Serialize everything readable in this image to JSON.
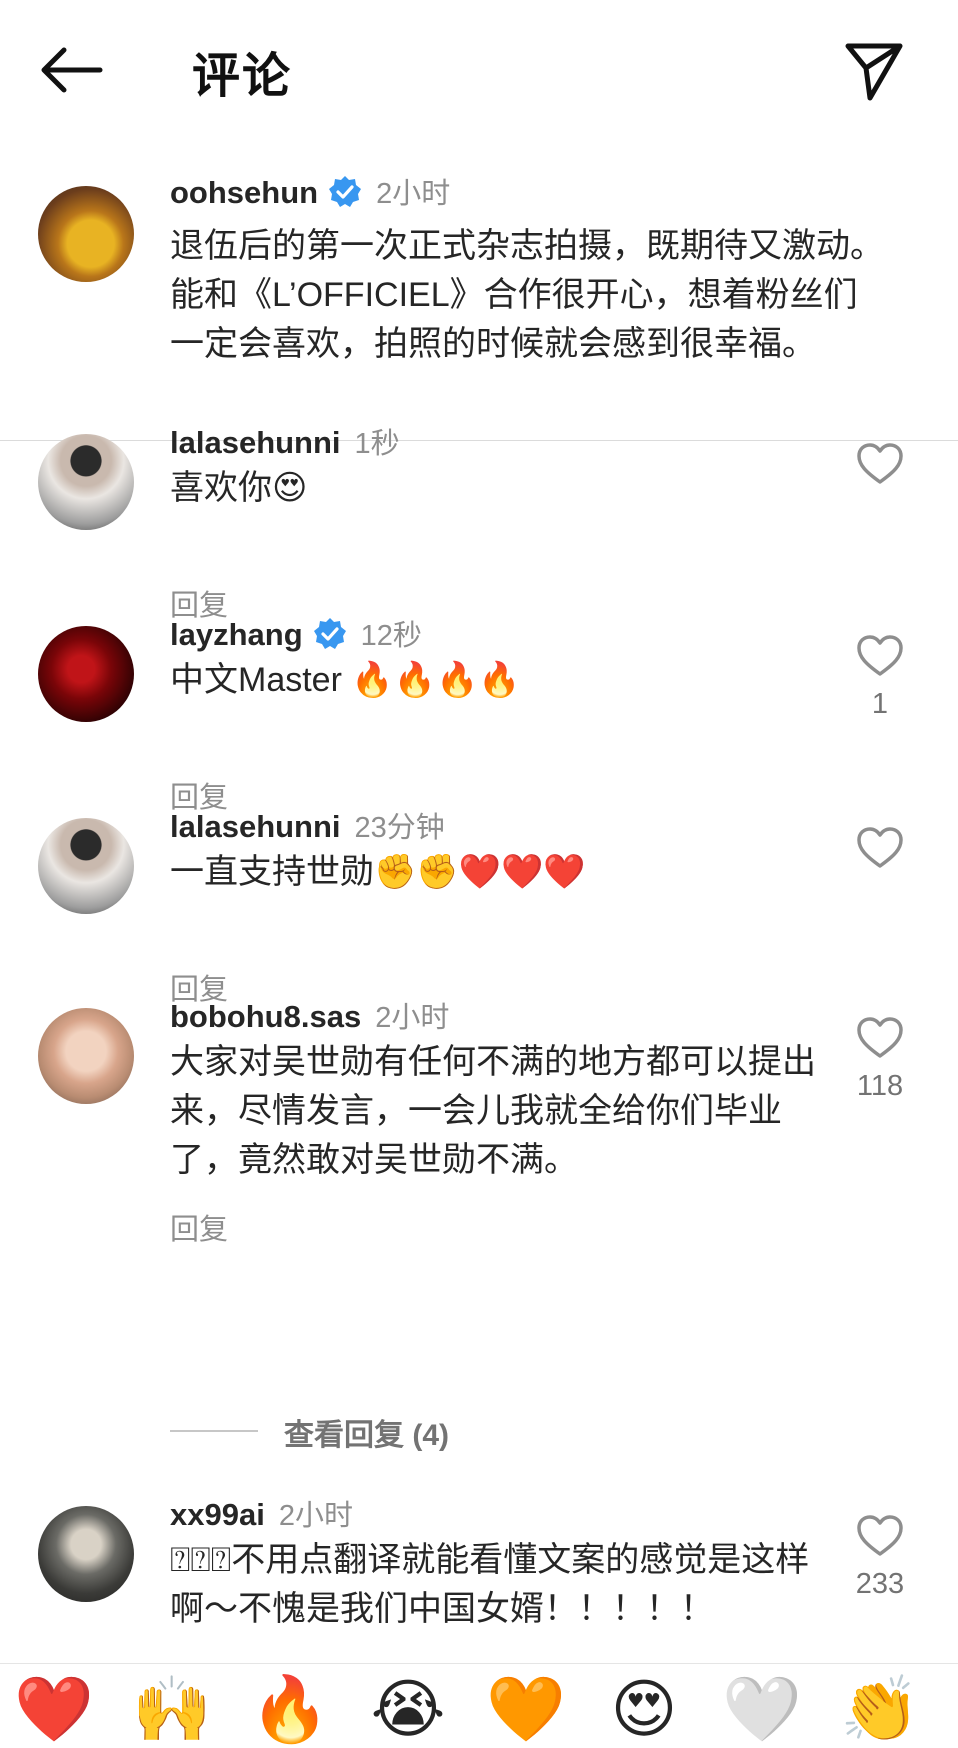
{
  "header": {
    "title": "评论"
  },
  "caption": {
    "username": "oohsehun",
    "time": "2小时",
    "text": "退伍后的第一次正式杂志拍摄，既期待又激动。能和《L’OFFICIEL》合作很开心，想着粉丝们一定会喜欢，拍照的时候就会感到很幸福。"
  },
  "comments": [
    {
      "username": "lalasehunni",
      "time": "1秒",
      "text": "喜欢你😍",
      "reply": "回复",
      "likes": ""
    },
    {
      "username": "layzhang",
      "time": "12秒",
      "text": "中文Master 🔥🔥🔥🔥",
      "reply": "回复",
      "likes": "1"
    },
    {
      "username": "lalasehunni",
      "time": "23分钟",
      "text": "一直支持世勋✊✊❤️❤️❤️",
      "reply": "回复",
      "likes": ""
    },
    {
      "username": "bobohu8.sas",
      "time": "2小时",
      "text": "大家对吴世勋有任何不满的地方都可以提出来，尽情发言，一会儿我就全给你们毕业了，竟然敢对吴世勋不满。",
      "reply": "回复",
      "likes": "118"
    },
    {
      "username": "xx99ai",
      "time": "2小时",
      "text": "⍰⍰⍰不用点翻译就能看懂文案的感觉是这样啊～不愧是我们中国女婿！！！！！",
      "reply": "",
      "likes": "233"
    }
  ],
  "view_replies": "查看回复 (4)",
  "emoji_bar": [
    "❤️",
    "🙌",
    "🔥",
    "😭",
    "🧡",
    "😍",
    "🤍",
    "👏"
  ]
}
